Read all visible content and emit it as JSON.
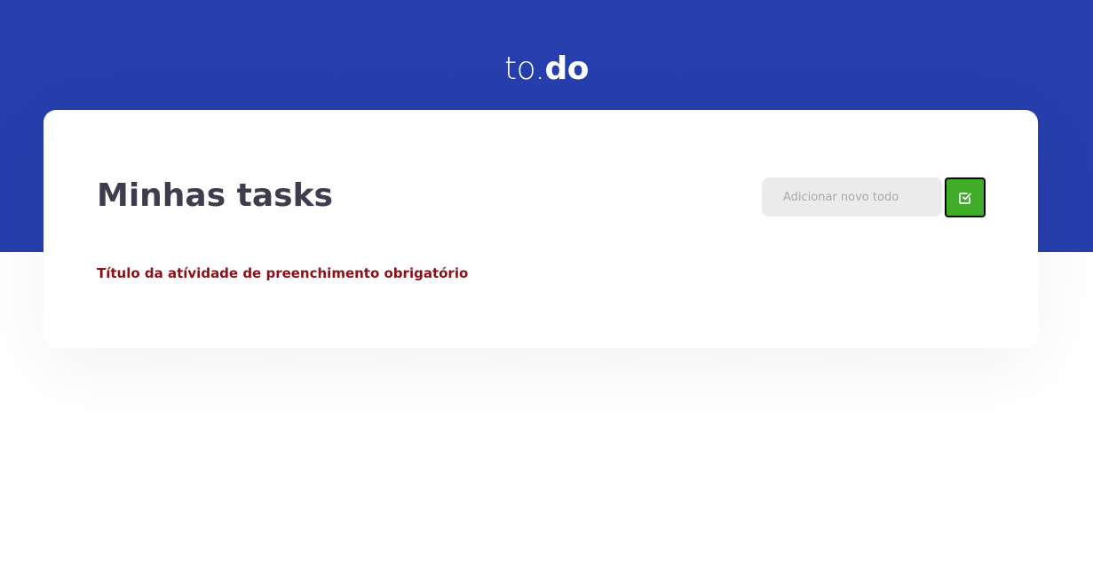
{
  "logo": {
    "light": "to.",
    "bold": "do"
  },
  "card": {
    "title": "Minhas tasks"
  },
  "new_todo": {
    "placeholder": "Adicionar novo todo",
    "value": "",
    "button_icon": "check-square-icon"
  },
  "error": {
    "message": "Título da atívidade de preenchimento obrigatório"
  },
  "colors": {
    "header_background": "#273fad",
    "add_button": "#3fad27",
    "error_text": "#8b0f16",
    "title_text": "#3d3d4d"
  }
}
